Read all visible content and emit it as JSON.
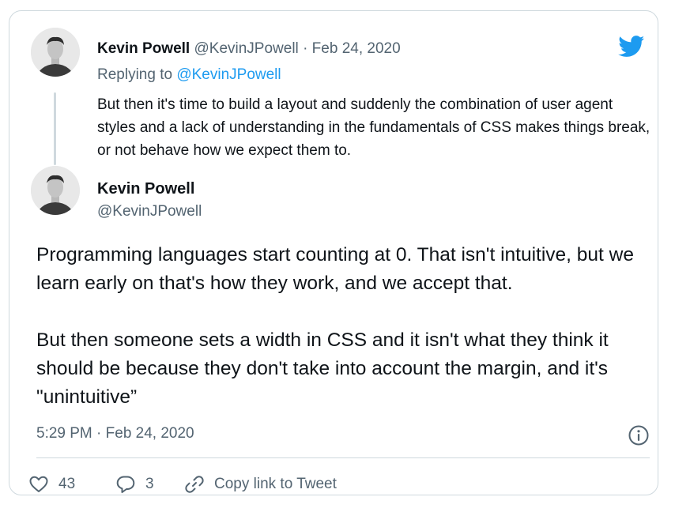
{
  "reply_tweet": {
    "author_name": "Kevin Powell",
    "author_handle": "@KevinJPowell",
    "separator": "·",
    "date": "Feb 24, 2020",
    "replying_label": "Replying to",
    "replying_handle": "@KevinJPowell",
    "text": "But then it's time to build a layout and suddenly the combination of user agent styles and a lack of understanding in the fundamentals of CSS makes things break, or not behave how we expect them to."
  },
  "main_tweet": {
    "author_name": "Kevin Powell",
    "author_handle": "@KevinJPowell",
    "paragraphs": [
      "Programming languages start counting at 0. That isn't intuitive, but we learn early on that's how they work, and we accept that.",
      "But then someone sets a width in CSS and it isn't what they think it should be because they don't take into account the margin, and it's \"unintuitive”"
    ],
    "timestamp": "5:29 PM · Feb 24, 2020"
  },
  "actions": {
    "likes": "43",
    "replies": "3",
    "copy_link_label": "Copy link to Tweet"
  },
  "icons": {
    "logo": "twitter-bird-icon",
    "like": "heart-icon",
    "reply": "speech-bubble-icon",
    "copy": "link-icon",
    "info": "info-icon"
  },
  "colors": {
    "accent": "#1d9bf0",
    "muted": "#536471",
    "border": "#cfd9de",
    "text": "#0f1419"
  }
}
